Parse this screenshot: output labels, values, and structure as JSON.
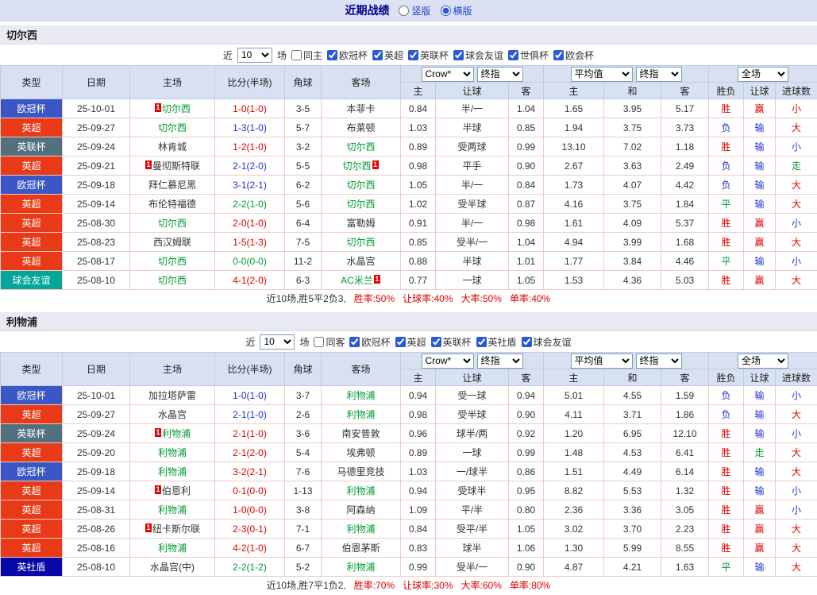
{
  "topbar": {
    "title": "近期战绩",
    "radio_vertical": "竖版",
    "radio_horizontal": "横版"
  },
  "filter_labels": {
    "near": "近",
    "games": "场"
  },
  "table_header": {
    "type": "类型",
    "date": "日期",
    "home": "主场",
    "score": "比分(半场)",
    "corner": "角球",
    "away": "客场",
    "bookmaker_select": "Crow*",
    "final_select": "终指",
    "avg_select": "平均值",
    "final_select2": "终指",
    "scope_select": "全场",
    "sub_home": "主",
    "sub_handicap": "让球",
    "sub_away": "客",
    "sub_home2": "主",
    "sub_draw": "和",
    "sub_away2": "客",
    "result": "胜负",
    "handicap": "让球",
    "goals": "进球数"
  },
  "league_colors": {
    "欧冠杯": "#3b57c6",
    "英超": "#e83a17",
    "英联杯": "#53707e",
    "球会友谊": "#01a69a",
    "英社盾": "#0706a6"
  },
  "sections": [
    {
      "team": "切尔西",
      "filter": {
        "count": "10",
        "venue": "同主",
        "leagues": [
          "欧冠杯",
          "英超",
          "英联杯",
          "球会友谊",
          "世俱杯",
          "欧会杯"
        ]
      },
      "rows": [
        {
          "type": "欧冠杯",
          "date": "25-10-01",
          "home": {
            "name": "切尔西",
            "hl": true,
            "badge": "1",
            "badge_pos": "before"
          },
          "score": {
            "text": "1-0(1-0)",
            "color": "r"
          },
          "corner": "3-5",
          "away": {
            "name": "本菲卡"
          },
          "crown": [
            "0.84",
            "半/一",
            "1.04"
          ],
          "avg": [
            "1.65",
            "3.95",
            "5.17"
          ],
          "result": {
            "text": "胜",
            "color": "r"
          },
          "handicap": {
            "text": "赢",
            "color": "r"
          },
          "goals": {
            "text": "小",
            "color": "r"
          }
        },
        {
          "type": "英超",
          "date": "25-09-27",
          "home": {
            "name": "切尔西",
            "hl": true
          },
          "score": {
            "text": "1-3(1-0)",
            "color": "b"
          },
          "corner": "5-7",
          "away": {
            "name": "布莱顿"
          },
          "crown": [
            "1.03",
            "半球",
            "0.85"
          ],
          "avg": [
            "1.94",
            "3.75",
            "3.73"
          ],
          "result": {
            "text": "负",
            "color": "b"
          },
          "handicap": {
            "text": "输",
            "color": "b"
          },
          "goals": {
            "text": "大",
            "color": "r"
          }
        },
        {
          "type": "英联杯",
          "date": "25-09-24",
          "home": {
            "name": "林肯城"
          },
          "score": {
            "text": "1-2(1-0)",
            "color": "r"
          },
          "corner": "3-2",
          "away": {
            "name": "切尔西",
            "hl": true
          },
          "crown": [
            "0.89",
            "受两球",
            "0.99"
          ],
          "avg": [
            "13.10",
            "7.02",
            "1.18"
          ],
          "result": {
            "text": "胜",
            "color": "r"
          },
          "handicap": {
            "text": "输",
            "color": "b"
          },
          "goals": {
            "text": "小",
            "color": "b"
          }
        },
        {
          "type": "英超",
          "date": "25-09-21",
          "home": {
            "name": "曼彻斯特联",
            "badge": "1",
            "badge_pos": "before"
          },
          "score": {
            "text": "2-1(2-0)",
            "color": "b"
          },
          "corner": "5-5",
          "away": {
            "name": "切尔西",
            "hl": true,
            "badge": "1",
            "badge_pos": "after"
          },
          "crown": [
            "0.98",
            "平手",
            "0.90"
          ],
          "avg": [
            "2.67",
            "3.63",
            "2.49"
          ],
          "result": {
            "text": "负",
            "color": "b"
          },
          "handicap": {
            "text": "输",
            "color": "b"
          },
          "goals": {
            "text": "走",
            "color": "g"
          }
        },
        {
          "type": "欧冠杯",
          "date": "25-09-18",
          "home": {
            "name": "拜仁慕尼黑"
          },
          "score": {
            "text": "3-1(2-1)",
            "color": "b"
          },
          "corner": "6-2",
          "away": {
            "name": "切尔西",
            "hl": true
          },
          "crown": [
            "1.05",
            "半/一",
            "0.84"
          ],
          "avg": [
            "1.73",
            "4.07",
            "4.42"
          ],
          "result": {
            "text": "负",
            "color": "b"
          },
          "handicap": {
            "text": "输",
            "color": "b"
          },
          "goals": {
            "text": "大",
            "color": "r"
          }
        },
        {
          "type": "英超",
          "date": "25-09-14",
          "home": {
            "name": "布伦特福德"
          },
          "score": {
            "text": "2-2(1-0)",
            "color": "g"
          },
          "corner": "5-6",
          "away": {
            "name": "切尔西",
            "hl": true
          },
          "crown": [
            "1.02",
            "受半球",
            "0.87"
          ],
          "avg": [
            "4.16",
            "3.75",
            "1.84"
          ],
          "result": {
            "text": "平",
            "color": "g"
          },
          "handicap": {
            "text": "输",
            "color": "b"
          },
          "goals": {
            "text": "大",
            "color": "r"
          }
        },
        {
          "type": "英超",
          "date": "25-08-30",
          "home": {
            "name": "切尔西",
            "hl": true
          },
          "score": {
            "text": "2-0(1-0)",
            "color": "r"
          },
          "corner": "6-4",
          "away": {
            "name": "富勒姆"
          },
          "crown": [
            "0.91",
            "半/一",
            "0.98"
          ],
          "avg": [
            "1.61",
            "4.09",
            "5.37"
          ],
          "result": {
            "text": "胜",
            "color": "r"
          },
          "handicap": {
            "text": "赢",
            "color": "r"
          },
          "goals": {
            "text": "小",
            "color": "b"
          }
        },
        {
          "type": "英超",
          "date": "25-08-23",
          "home": {
            "name": "西汉姆联"
          },
          "score": {
            "text": "1-5(1-3)",
            "color": "r"
          },
          "corner": "7-5",
          "away": {
            "name": "切尔西",
            "hl": true
          },
          "crown": [
            "0.85",
            "受半/一",
            "1.04"
          ],
          "avg": [
            "4.94",
            "3.99",
            "1.68"
          ],
          "result": {
            "text": "胜",
            "color": "r"
          },
          "handicap": {
            "text": "赢",
            "color": "r"
          },
          "goals": {
            "text": "大",
            "color": "r"
          }
        },
        {
          "type": "英超",
          "date": "25-08-17",
          "home": {
            "name": "切尔西",
            "hl": true
          },
          "score": {
            "text": "0-0(0-0)",
            "color": "g"
          },
          "corner": "11-2",
          "away": {
            "name": "水晶宫"
          },
          "crown": [
            "0.88",
            "半球",
            "1.01"
          ],
          "avg": [
            "1.77",
            "3.84",
            "4.46"
          ],
          "result": {
            "text": "平",
            "color": "g"
          },
          "handicap": {
            "text": "输",
            "color": "b"
          },
          "goals": {
            "text": "小",
            "color": "b"
          }
        },
        {
          "type": "球会友谊",
          "date": "25-08-10",
          "home": {
            "name": "切尔西",
            "hl": true
          },
          "score": {
            "text": "4-1(2-0)",
            "color": "r"
          },
          "corner": "6-3",
          "away": {
            "name": "AC米兰",
            "hl": true,
            "badge": "1",
            "badge_pos": "after"
          },
          "crown": [
            "0.77",
            "一球",
            "1.05"
          ],
          "avg": [
            "1.53",
            "4.36",
            "5.03"
          ],
          "result": {
            "text": "胜",
            "color": "r"
          },
          "handicap": {
            "text": "赢",
            "color": "r"
          },
          "goals": {
            "text": "大",
            "color": "r"
          }
        }
      ],
      "summary": {
        "lead": "近10场,胜5平2负3,",
        "stats": [
          "胜率:50%",
          "让球率:40%",
          "大率:50%",
          "单率:40%"
        ]
      }
    },
    {
      "team": "利物浦",
      "filter": {
        "count": "10",
        "venue": "同客",
        "leagues": [
          "欧冠杯",
          "英超",
          "英联杯",
          "英社盾",
          "球会友谊"
        ]
      },
      "rows": [
        {
          "type": "欧冠杯",
          "date": "25-10-01",
          "home": {
            "name": "加拉塔萨雷"
          },
          "score": {
            "text": "1-0(1-0)",
            "color": "b"
          },
          "corner": "3-7",
          "away": {
            "name": "利物浦",
            "hl": true
          },
          "crown": [
            "0.94",
            "受一球",
            "0.94"
          ],
          "avg": [
            "5.01",
            "4.55",
            "1.59"
          ],
          "result": {
            "text": "负",
            "color": "b"
          },
          "handicap": {
            "text": "输",
            "color": "b"
          },
          "goals": {
            "text": "小",
            "color": "b"
          }
        },
        {
          "type": "英超",
          "date": "25-09-27",
          "home": {
            "name": "水晶宫"
          },
          "score": {
            "text": "2-1(1-0)",
            "color": "b"
          },
          "corner": "2-6",
          "away": {
            "name": "利物浦",
            "hl": true
          },
          "crown": [
            "0.98",
            "受半球",
            "0.90"
          ],
          "avg": [
            "4.11",
            "3.71",
            "1.86"
          ],
          "result": {
            "text": "负",
            "color": "b"
          },
          "handicap": {
            "text": "输",
            "color": "b"
          },
          "goals": {
            "text": "大",
            "color": "r"
          }
        },
        {
          "type": "英联杯",
          "date": "25-09-24",
          "home": {
            "name": "利物浦",
            "hl": true,
            "badge": "1",
            "badge_pos": "before"
          },
          "score": {
            "text": "2-1(1-0)",
            "color": "r"
          },
          "corner": "3-6",
          "away": {
            "name": "南安普敦"
          },
          "crown": [
            "0.96",
            "球半/两",
            "0.92"
          ],
          "avg": [
            "1.20",
            "6.95",
            "12.10"
          ],
          "result": {
            "text": "胜",
            "color": "r"
          },
          "handicap": {
            "text": "输",
            "color": "b"
          },
          "goals": {
            "text": "小",
            "color": "b"
          }
        },
        {
          "type": "英超",
          "date": "25-09-20",
          "home": {
            "name": "利物浦",
            "hl": true
          },
          "score": {
            "text": "2-1(2-0)",
            "color": "r"
          },
          "corner": "5-4",
          "away": {
            "name": "埃弗顿"
          },
          "crown": [
            "0.89",
            "一球",
            "0.99"
          ],
          "avg": [
            "1.48",
            "4.53",
            "6.41"
          ],
          "result": {
            "text": "胜",
            "color": "r"
          },
          "handicap": {
            "text": "走",
            "color": "g"
          },
          "goals": {
            "text": "大",
            "color": "r"
          }
        },
        {
          "type": "欧冠杯",
          "date": "25-09-18",
          "home": {
            "name": "利物浦",
            "hl": true
          },
          "score": {
            "text": "3-2(2-1)",
            "color": "r"
          },
          "corner": "7-6",
          "away": {
            "name": "马德里竞技"
          },
          "crown": [
            "1.03",
            "一/球半",
            "0.86"
          ],
          "avg": [
            "1.51",
            "4.49",
            "6.14"
          ],
          "result": {
            "text": "胜",
            "color": "r"
          },
          "handicap": {
            "text": "输",
            "color": "b"
          },
          "goals": {
            "text": "大",
            "color": "r"
          }
        },
        {
          "type": "英超",
          "date": "25-09-14",
          "home": {
            "name": "伯恩利",
            "badge": "1",
            "badge_pos": "before"
          },
          "score": {
            "text": "0-1(0-0)",
            "color": "r"
          },
          "corner": "1-13",
          "away": {
            "name": "利物浦",
            "hl": true
          },
          "crown": [
            "0.94",
            "受球半",
            "0.95"
          ],
          "avg": [
            "8.82",
            "5.53",
            "1.32"
          ],
          "result": {
            "text": "胜",
            "color": "r"
          },
          "handicap": {
            "text": "输",
            "color": "b"
          },
          "goals": {
            "text": "小",
            "color": "b"
          }
        },
        {
          "type": "英超",
          "date": "25-08-31",
          "home": {
            "name": "利物浦",
            "hl": true
          },
          "score": {
            "text": "1-0(0-0)",
            "color": "r"
          },
          "corner": "3-8",
          "away": {
            "name": "阿森纳"
          },
          "crown": [
            "1.09",
            "平/半",
            "0.80"
          ],
          "avg": [
            "2.36",
            "3.36",
            "3.05"
          ],
          "result": {
            "text": "胜",
            "color": "r"
          },
          "handicap": {
            "text": "赢",
            "color": "r"
          },
          "goals": {
            "text": "小",
            "color": "b"
          }
        },
        {
          "type": "英超",
          "date": "25-08-26",
          "home": {
            "name": "纽卡斯尔联",
            "badge": "1",
            "badge_pos": "before"
          },
          "score": {
            "text": "2-3(0-1)",
            "color": "r"
          },
          "corner": "7-1",
          "away": {
            "name": "利物浦",
            "hl": true
          },
          "crown": [
            "0.84",
            "受平/半",
            "1.05"
          ],
          "avg": [
            "3.02",
            "3.70",
            "2.23"
          ],
          "result": {
            "text": "胜",
            "color": "r"
          },
          "handicap": {
            "text": "赢",
            "color": "r"
          },
          "goals": {
            "text": "大",
            "color": "r"
          }
        },
        {
          "type": "英超",
          "date": "25-08-16",
          "home": {
            "name": "利物浦",
            "hl": true
          },
          "score": {
            "text": "4-2(1-0)",
            "color": "r"
          },
          "corner": "6-7",
          "away": {
            "name": "伯恩茅斯"
          },
          "crown": [
            "0.83",
            "球半",
            "1.06"
          ],
          "avg": [
            "1.30",
            "5.99",
            "8.55"
          ],
          "result": {
            "text": "胜",
            "color": "r"
          },
          "handicap": {
            "text": "赢",
            "color": "r"
          },
          "goals": {
            "text": "大",
            "color": "r"
          }
        },
        {
          "type": "英社盾",
          "date": "25-08-10",
          "home": {
            "name": "水晶宫(中)"
          },
          "score": {
            "text": "2-2(1-2)",
            "color": "g"
          },
          "corner": "5-2",
          "away": {
            "name": "利物浦",
            "hl": true
          },
          "crown": [
            "0.99",
            "受半/一",
            "0.90"
          ],
          "avg": [
            "4.87",
            "4.21",
            "1.63"
          ],
          "result": {
            "text": "平",
            "color": "g"
          },
          "handicap": {
            "text": "输",
            "color": "b"
          },
          "goals": {
            "text": "大",
            "color": "r"
          }
        }
      ],
      "summary": {
        "lead": "近10场,胜7平1负2,",
        "stats": [
          "胜率:70%",
          "让球率:30%",
          "大率:60%",
          "单率:80%"
        ]
      }
    }
  ]
}
